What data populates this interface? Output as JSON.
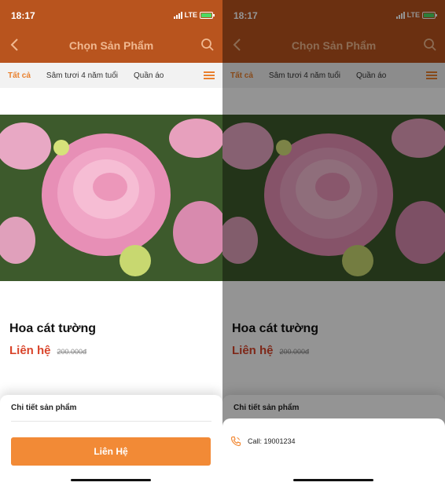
{
  "status": {
    "time": "18:17",
    "network": "LTE"
  },
  "nav": {
    "title": "Chọn Sản Phẩm"
  },
  "tabs": [
    {
      "label": "Tất cả",
      "active": true
    },
    {
      "label": "Sâm tươi 4 năm tuổi",
      "active": false
    },
    {
      "label": "Quần áo",
      "active": false
    }
  ],
  "product": {
    "name": "Hoa cát tường",
    "price": "Liên hệ",
    "old_price": "200.000đ",
    "image": "pink-lisianthus-photo"
  },
  "detail": {
    "title": "Chi tiết sản phẩm"
  },
  "contact_button": "Liên Hệ",
  "action_sheet": {
    "call_label": "Call: 19001234"
  },
  "colors": {
    "brand": "#b8541e",
    "accent": "#f28a36",
    "price": "#d9452b"
  }
}
